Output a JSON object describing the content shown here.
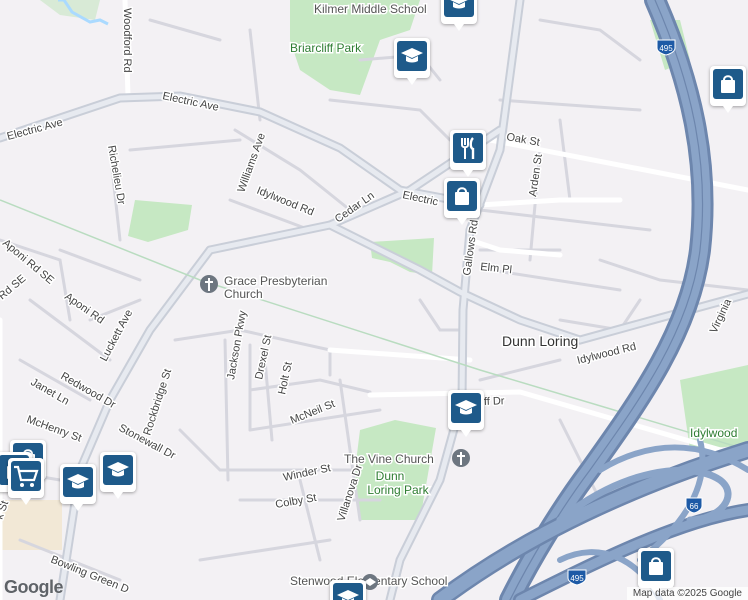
{
  "map": {
    "roads": {
      "woodford_rd": "Woodford Rd",
      "electric_ave_1": "Electric Ave",
      "electric_ave_2": "Electric Ave",
      "electric_ave_3": "Electric",
      "richelieu_dr": "Richelieu Dr",
      "williams_ave": "Williams Ave",
      "cedar_ln": "Cedar Ln",
      "idylwood_rd_1": "Idylwood Rd",
      "idylwood_rd_2": "Idylwood Rd",
      "aponi_rd_se": "Aponi Rd SE",
      "aponi_rd": "Aponi Rd",
      "rd_se": "Rd SE",
      "luckett_ave": "Luckett Ave",
      "redwood_dr": "Redwood Dr",
      "janet_ln": "Janet Ln",
      "rockbridge_st": "Rockbridge St",
      "jackson_pkwy": "Jackson Pkwy",
      "drexel_st": "Drexel St",
      "holt_st": "Holt St",
      "mcneil_st": "McNeil St",
      "mchenry_st": "McHenry St",
      "stonewall_dr": "Stonewall Dr",
      "winder_st": "Winder St",
      "colby_st": "Colby St",
      "villanova_dr": "Villanova Dr",
      "bowling_green_dr": "Bowling Green D",
      "gallows_rd": "Gallows Rd",
      "oak_st": "Oak St",
      "arden_st": "Arden St",
      "elm_pl": "Elm Pl",
      "ff_dr": "ff Dr",
      "virginia": "Virginia",
      "k_st": "k St"
    },
    "places": {
      "kilmer": "Kilmer Middle School",
      "briarcliff": "Briarcliff Park",
      "grace_line1": "Grace Presbyterian",
      "grace_line2": "Church",
      "dunn_loring": "Dunn Loring",
      "vine_church": "The Vine Church",
      "dunn_park_line1": "Dunn",
      "dunn_park_line2": "Loring Park",
      "idylwood": "Idylwood",
      "stenwood": "Stenwood Elementary School"
    },
    "highways": {
      "i495_top": "495",
      "i495_bottom": "495",
      "i66": "66"
    },
    "icons": [
      "school-icon",
      "restaurant-icon",
      "shopping-bag-icon",
      "shopping-cart-icon",
      "church-icon"
    ],
    "colors": {
      "pin": "#1e5a8a",
      "park": "#c6e8c3",
      "highway": "#8aa4c8",
      "water": "#aadaff"
    },
    "logo": "Google",
    "attribution": "Map data ©2025 Google"
  }
}
